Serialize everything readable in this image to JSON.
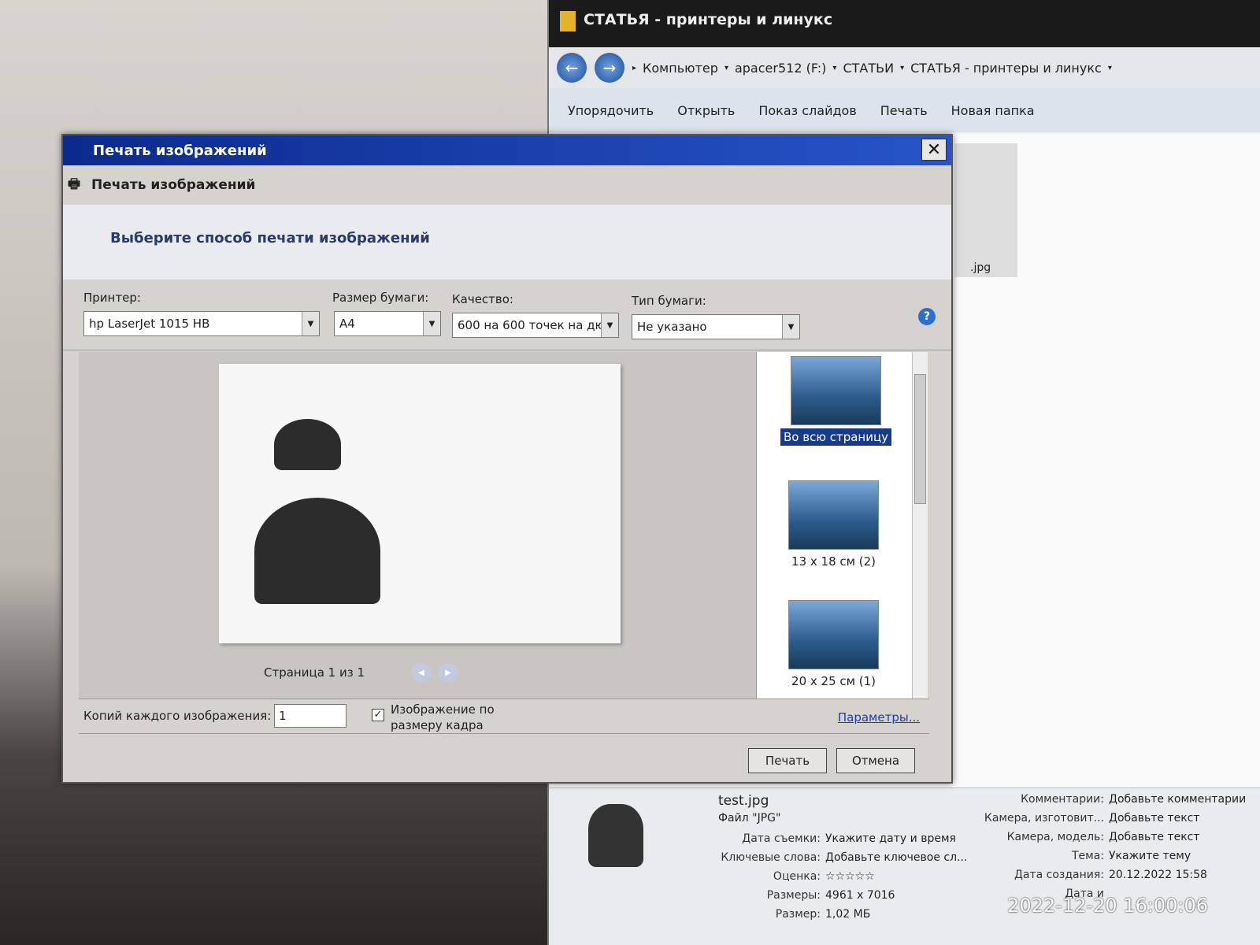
{
  "explorer": {
    "title": "СТАТЬЯ - принтеры и линукс",
    "breadcrumb": [
      "Компьютер",
      "apacer512 (F:)",
      "СТАТЬИ",
      "СТАТЬЯ - принтеры и линукс"
    ],
    "toolbar": [
      "Упорядочить",
      "Открыть",
      "Показ слайдов",
      "Печать",
      "Новая папка"
    ],
    "thumb_label": ".jpg",
    "details": {
      "filename": "test.jpg",
      "filetype": "Файл \"JPG\"",
      "left": [
        {
          "k": "Дата съемки:",
          "v": "Укажите дату и время"
        },
        {
          "k": "Ключевые слова:",
          "v": "Добавьте ключевое сл..."
        },
        {
          "k": "Оценка:",
          "v": "☆☆☆☆☆"
        },
        {
          "k": "Размеры:",
          "v": "4961 x 7016"
        },
        {
          "k": "Размер:",
          "v": "1,02 МБ"
        }
      ],
      "right": [
        {
          "k": "Комментарии:",
          "v": "Добавьте комментарии"
        },
        {
          "k": "Камера, изготовит...",
          "v": "Добавьте текст"
        },
        {
          "k": "Камера, модель:",
          "v": "Добавьте текст"
        },
        {
          "k": "Тема:",
          "v": "Укажите тему"
        },
        {
          "k": "Дата создания:",
          "v": "20.12.2022 15:58"
        },
        {
          "k": "Дата и",
          "v": ""
        }
      ],
      "rating": 0
    }
  },
  "timestamp": "2022-12-20 16:00:06",
  "dialog": {
    "title": "Печать изображений",
    "subtitle": "Печать изображений",
    "banner": "Выберите способ печати изображений",
    "printer_label": "Принтер:",
    "printer": "hp LaserJet 1015 HB",
    "paper_size_label": "Размер бумаги:",
    "paper_size": "A4",
    "quality_label": "Качество:",
    "quality": "600 на 600 точек на дю",
    "paper_type_label": "Тип бумаги:",
    "paper_type": "Не указано",
    "help": "?",
    "page_info": "Страница 1 из 1",
    "layouts": [
      {
        "label": "Во всю страницу"
      },
      {
        "label": "13 x 18 см (2)"
      },
      {
        "label": "20 x 25 см (1)"
      }
    ],
    "copies_label": "Копий каждого изображения:",
    "copies": "1",
    "fit_label": "Изображение по размеру кадра",
    "fit_checked": true,
    "options_link": "Параметры...",
    "print_button": "Печать",
    "cancel_button": "Отмена"
  }
}
